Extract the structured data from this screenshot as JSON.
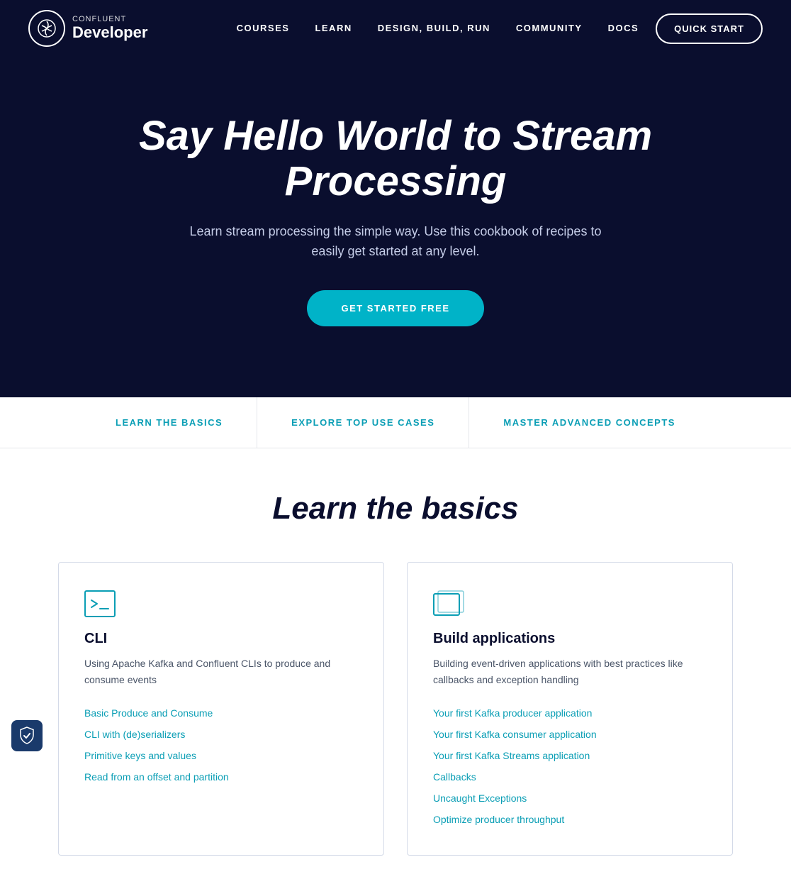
{
  "brand": {
    "confluent": "CONFLUENT",
    "developer": "Developer"
  },
  "nav": {
    "links": [
      {
        "id": "courses",
        "label": "COURSES"
      },
      {
        "id": "learn",
        "label": "LEARN"
      },
      {
        "id": "design-build-run",
        "label": "DESIGN, BUILD, RUN"
      },
      {
        "id": "community",
        "label": "COMMUNITY"
      },
      {
        "id": "docs",
        "label": "DOCS"
      }
    ],
    "quick_start": "QUICK START"
  },
  "hero": {
    "title": "Say Hello World to Stream Processing",
    "subtitle": "Learn stream processing the simple way. Use this cookbook of recipes to easily get started at any level.",
    "cta": "GET STARTED FREE"
  },
  "tabs": [
    {
      "id": "learn-basics",
      "label": "LEARN THE BASICS",
      "active": true
    },
    {
      "id": "explore-use-cases",
      "label": "EXPLORE TOP USE CASES",
      "active": false
    },
    {
      "id": "master-advanced",
      "label": "MASTER ADVANCED CONCEPTS",
      "active": false
    }
  ],
  "learn_section": {
    "title": "Learn the basics"
  },
  "cards": [
    {
      "id": "cli",
      "title": "CLI",
      "description": "Using Apache Kafka and Confluent CLIs to produce and consume events",
      "links": [
        {
          "label": "Basic Produce and Consume",
          "href": "#"
        },
        {
          "label": "CLI with (de)serializers",
          "href": "#"
        },
        {
          "label": "Primitive keys and values",
          "href": "#"
        },
        {
          "label": "Read from an offset and partition",
          "href": "#"
        }
      ]
    },
    {
      "id": "build-applications",
      "title": "Build applications",
      "description": "Building event-driven applications with best practices like callbacks and exception handling",
      "links": [
        {
          "label": "Your first Kafka producer application",
          "href": "#"
        },
        {
          "label": "Your first Kafka consumer application",
          "href": "#"
        },
        {
          "label": "Your first Kafka Streams application",
          "href": "#"
        },
        {
          "label": "Callbacks",
          "href": "#"
        },
        {
          "label": "Uncaught Exceptions",
          "href": "#"
        },
        {
          "label": "Optimize producer throughput",
          "href": "#"
        }
      ]
    }
  ],
  "colors": {
    "dark_navy": "#0a0e2e",
    "teal": "#00b3c8",
    "link_blue": "#0a9eb5"
  }
}
